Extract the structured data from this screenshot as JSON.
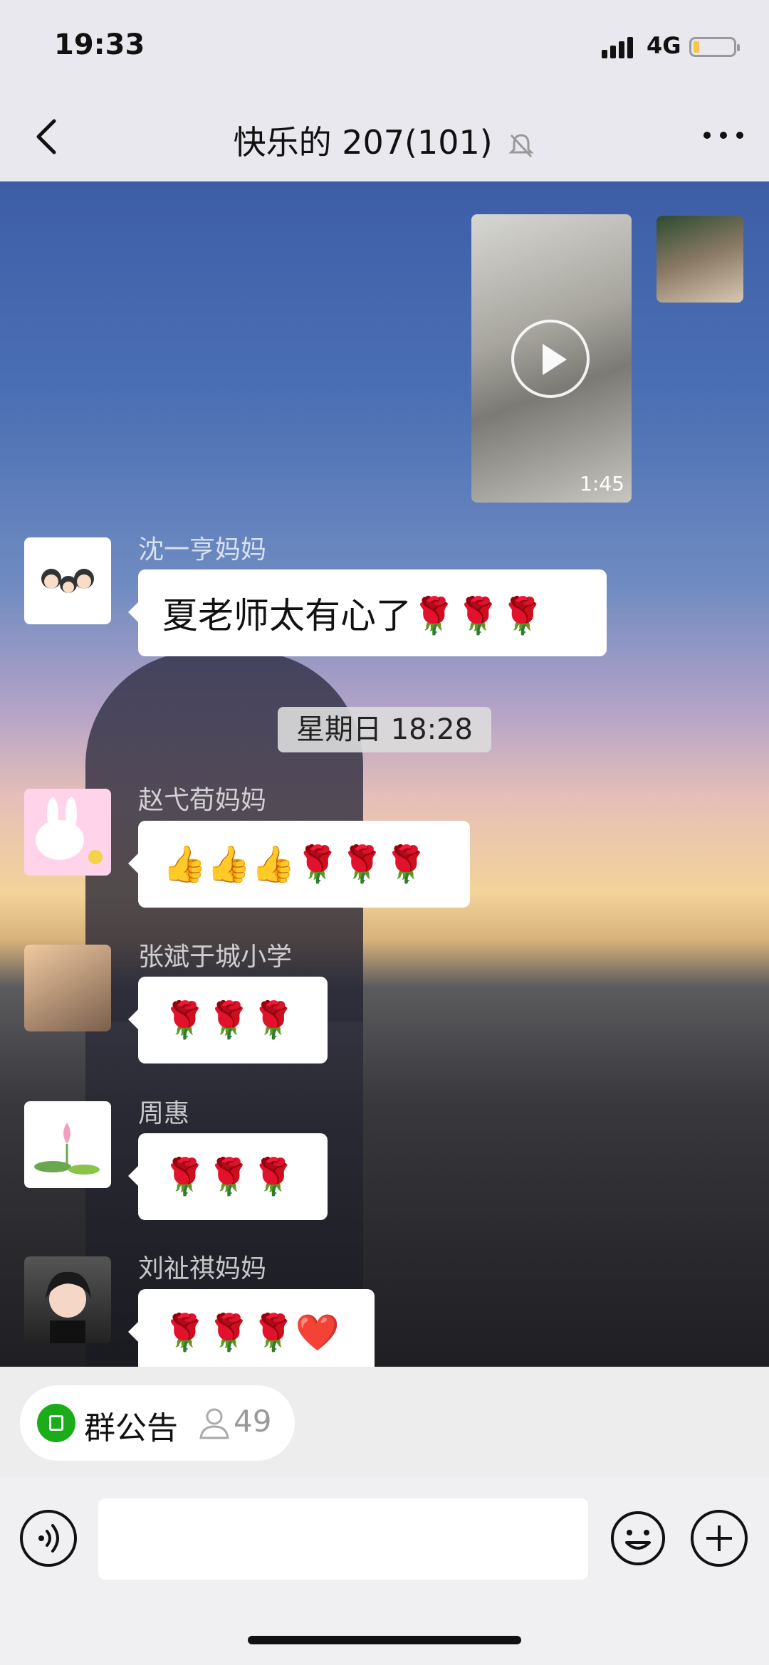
{
  "status": {
    "time": "19:33",
    "network": "4G"
  },
  "nav": {
    "title": "快乐的 207(101)"
  },
  "video": {
    "duration": "1:45"
  },
  "timestamp": "星期日 18:28",
  "messages": [
    {
      "name": "沈一亨妈妈",
      "text": "夏老师太有心了🌹🌹🌹"
    },
    {
      "name": "赵弋荀妈妈",
      "text": "👍👍👍🌹🌹🌹"
    },
    {
      "name": "张斌于城小学",
      "text": "🌹🌹🌹"
    },
    {
      "name": "周惠",
      "text": "🌹🌹🌹"
    },
    {
      "name": "刘祉祺妈妈",
      "text": "🌹🌹🌹❤️"
    }
  ],
  "notice": {
    "label": "群公告",
    "count": "49"
  },
  "input": {
    "value": ""
  }
}
